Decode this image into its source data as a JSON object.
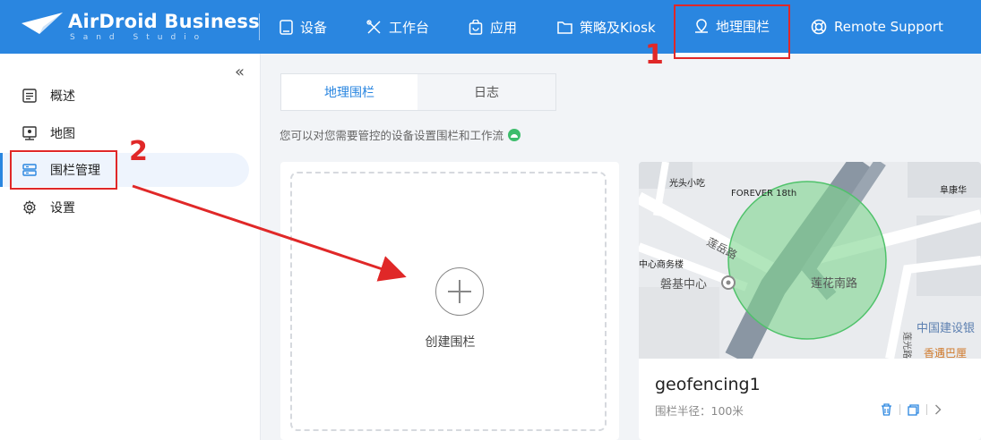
{
  "header": {
    "brand": "AirDroid Business",
    "brand_sub": "Sand Studio",
    "nav": [
      {
        "label": "设备",
        "icon": "tablet-icon"
      },
      {
        "label": "工作台",
        "icon": "tools-icon"
      },
      {
        "label": "应用",
        "icon": "app-bag-icon"
      },
      {
        "label": "策略及Kiosk",
        "icon": "folder-icon"
      },
      {
        "label": "地理围栏",
        "icon": "location-pin-icon",
        "active": true
      },
      {
        "label": "Remote Support",
        "icon": "lifebuoy-icon"
      }
    ]
  },
  "sidebar": {
    "collapse_glyph": "«",
    "items": [
      {
        "label": "概述",
        "icon": "list-icon"
      },
      {
        "label": "地图",
        "icon": "map-pin-icon"
      },
      {
        "label": "围栏管理",
        "icon": "server-icon",
        "active": true
      },
      {
        "label": "设置",
        "icon": "gear-icon"
      }
    ]
  },
  "main": {
    "tabs": [
      {
        "label": "地理围栏",
        "active": true
      },
      {
        "label": "日志"
      }
    ],
    "hint": "您可以对您需要管控的设备设置围栏和工作流",
    "create_label": "创建围栏",
    "geofence": {
      "name": "geofencing1",
      "radius_label": "围栏半径：100米",
      "map_labels": {
        "l1": "光头小吃",
        "l2": "FOREVER 18th",
        "l3": "阜康华",
        "l4": "莲岳路",
        "l5": "中心商务楼",
        "l6": "磐基中心",
        "l7": "莲花南路",
        "l8": "中国建设银",
        "l9": "香遇巴厘",
        "l10": "莲光路"
      }
    }
  },
  "annotations": {
    "step1": "1",
    "step2": "2"
  },
  "colors": {
    "primary": "#2a86e0",
    "annotation": "#e02828",
    "geofence_fill": "#7fd58f"
  }
}
